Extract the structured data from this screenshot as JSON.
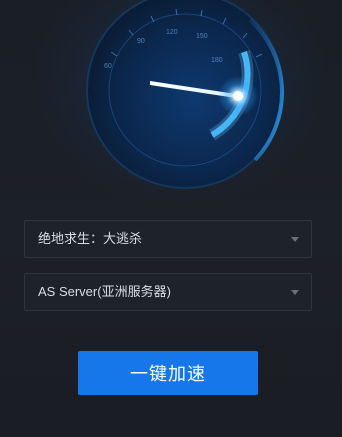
{
  "gauge": {
    "tick_labels": [
      "60",
      "90",
      "120",
      "150",
      "180"
    ],
    "accent_color": "#37b4ff",
    "glow_color": "#9fe0ff"
  },
  "game_select": {
    "value": "绝地求生：大逃杀"
  },
  "server_select": {
    "value": "AS Server(亚洲服务器)"
  },
  "accelerate_button": {
    "label": "一键加速",
    "color": "#1677ea"
  }
}
